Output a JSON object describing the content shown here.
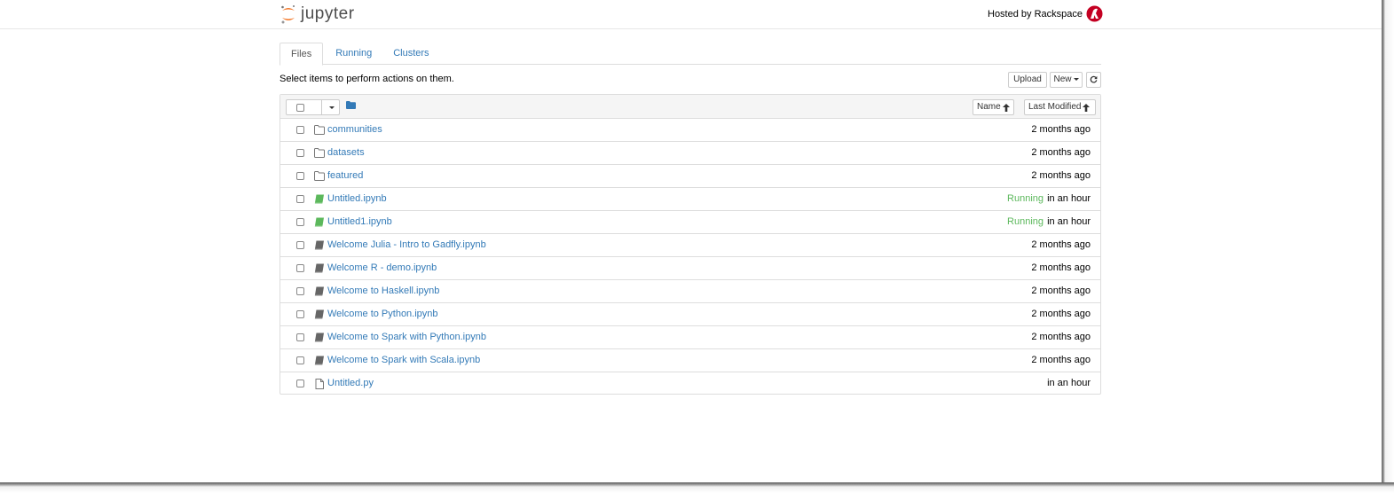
{
  "header": {
    "logo_text": "jupyter",
    "hosted_by": "Hosted by Rackspace",
    "colors": {
      "logo_orange": "#f37626",
      "rackspace_red": "#c40022"
    }
  },
  "tabs": [
    {
      "label": "Files",
      "active": true
    },
    {
      "label": "Running",
      "active": false
    },
    {
      "label": "Clusters",
      "active": false
    }
  ],
  "toolbar": {
    "instructions": "Select items to perform actions on them.",
    "upload_label": "Upload",
    "new_label": "New",
    "refresh_icon": "refresh-icon"
  },
  "list_header": {
    "sort_name_label": "Name",
    "sort_modified_label": "Last Modified"
  },
  "files": [
    {
      "name": "communities",
      "type": "folder",
      "status": "",
      "modified": "2 months ago"
    },
    {
      "name": "datasets",
      "type": "folder",
      "status": "",
      "modified": "2 months ago"
    },
    {
      "name": "featured",
      "type": "folder",
      "status": "",
      "modified": "2 months ago"
    },
    {
      "name": "Untitled.ipynb",
      "type": "notebook-running",
      "status": "Running",
      "modified": "in an hour"
    },
    {
      "name": "Untitled1.ipynb",
      "type": "notebook-running",
      "status": "Running",
      "modified": "in an hour"
    },
    {
      "name": "Welcome Julia - Intro to Gadfly.ipynb",
      "type": "notebook",
      "status": "",
      "modified": "2 months ago"
    },
    {
      "name": "Welcome R - demo.ipynb",
      "type": "notebook",
      "status": "",
      "modified": "2 months ago"
    },
    {
      "name": "Welcome to Haskell.ipynb",
      "type": "notebook",
      "status": "",
      "modified": "2 months ago"
    },
    {
      "name": "Welcome to Python.ipynb",
      "type": "notebook",
      "status": "",
      "modified": "2 months ago"
    },
    {
      "name": "Welcome to Spark with Python.ipynb",
      "type": "notebook",
      "status": "",
      "modified": "2 months ago"
    },
    {
      "name": "Welcome to Spark with Scala.ipynb",
      "type": "notebook",
      "status": "",
      "modified": "2 months ago"
    },
    {
      "name": "Untitled.py",
      "type": "file",
      "status": "",
      "modified": "in an hour"
    }
  ]
}
